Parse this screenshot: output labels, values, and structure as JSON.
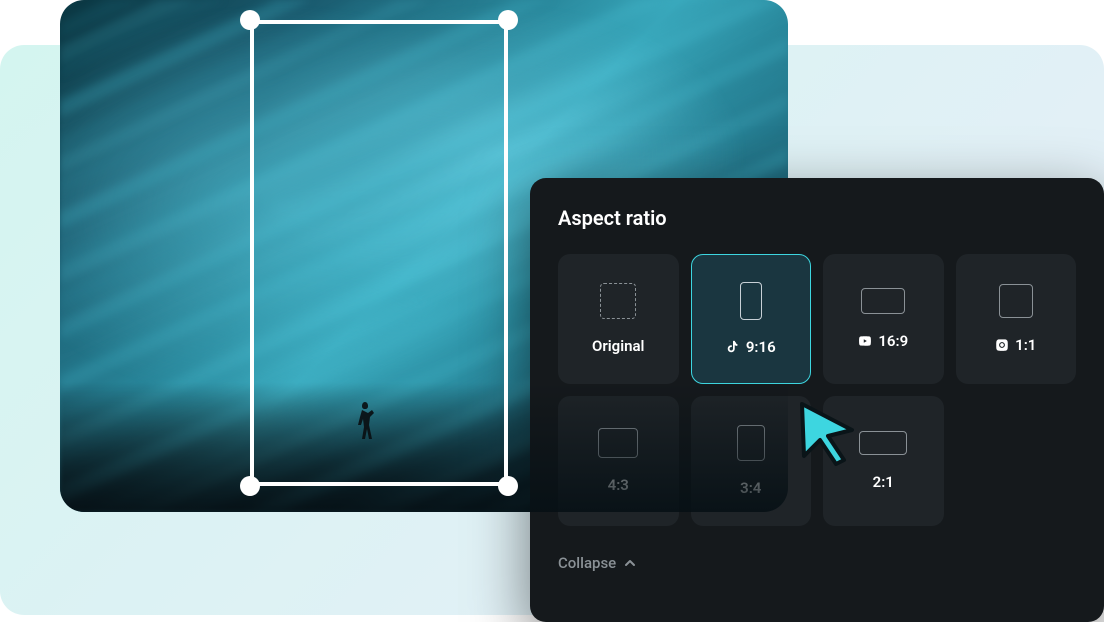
{
  "panel": {
    "title": "Aspect ratio",
    "collapse_label": "Collapse",
    "selected_index": 1,
    "ratios": [
      {
        "label": "Original",
        "platform": null,
        "shape": "original"
      },
      {
        "label": "9:16",
        "platform": "tiktok",
        "shape": "9-16"
      },
      {
        "label": "16:9",
        "platform": "youtube",
        "shape": "16-9"
      },
      {
        "label": "1:1",
        "platform": "instagram",
        "shape": "1-1"
      },
      {
        "label": "4:3",
        "platform": null,
        "shape": "4-3"
      },
      {
        "label": "3:4",
        "platform": null,
        "shape": "3-4"
      },
      {
        "label": "2:1",
        "platform": null,
        "shape": "2-1"
      }
    ]
  },
  "colors": {
    "accent": "#3dd6e0",
    "panel_bg": "#15191c",
    "tile_bg": "#1f2428",
    "tile_selected_bg": "#1a3640"
  }
}
